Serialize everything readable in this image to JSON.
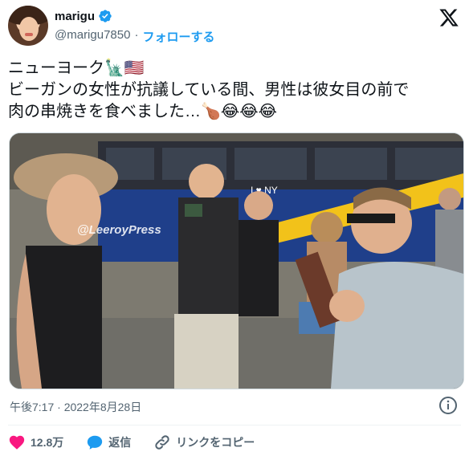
{
  "author": {
    "name": "marigu",
    "handle": "@marigu7850",
    "separator": "·",
    "follow_label": "フォローする"
  },
  "tweet": {
    "line1": "ニューヨーク🗽🇺🇸",
    "line2": "ビーガンの女性が抗議している間、男性は彼女目の前で",
    "line3": "肉の串焼きを食べました…🍗😂😂😂"
  },
  "media": {
    "watermark": "@LeeroyPress",
    "bus_sign": "I ♥ NY"
  },
  "timestamp": "午後7:17 · 2022年8月28日",
  "actions": {
    "likes": "12.8万",
    "reply_label": "返信",
    "copy_link_label": "リンクをコピー"
  },
  "colors": {
    "accent": "#1d9bf0",
    "like": "#f91880",
    "text": "#0f1419",
    "muted": "#536471"
  }
}
